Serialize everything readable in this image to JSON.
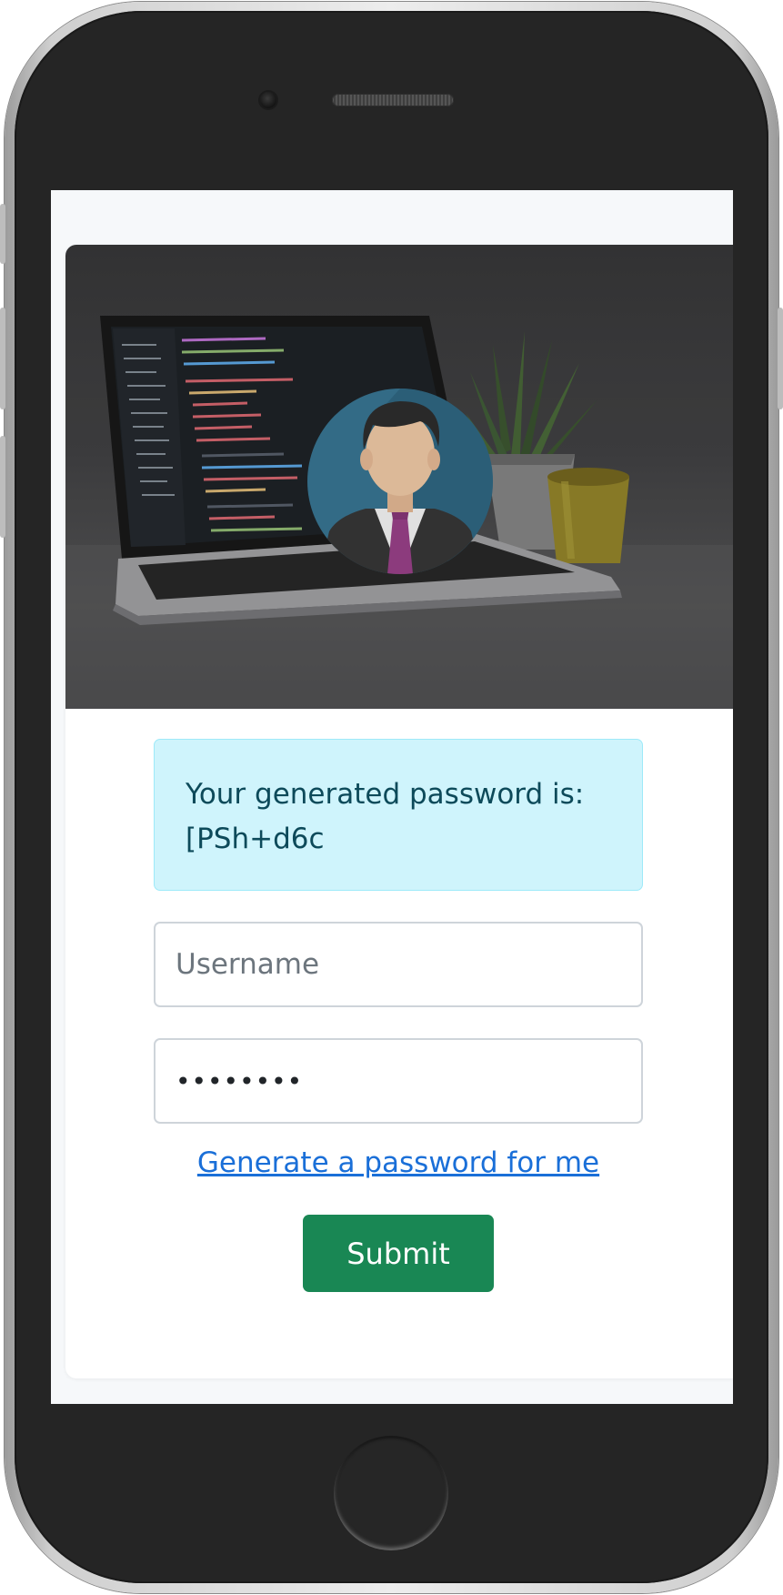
{
  "alert": {
    "message": "Your generated password is:",
    "password": "[PSh+d6c"
  },
  "form": {
    "username_placeholder": "Username",
    "password_value": "••••••••",
    "generate_link": "Generate a password for me",
    "submit_label": "Submit"
  },
  "colors": {
    "alert_bg": "#cff4fc",
    "submit_bg": "#198754",
    "link": "#1a6fd8"
  }
}
